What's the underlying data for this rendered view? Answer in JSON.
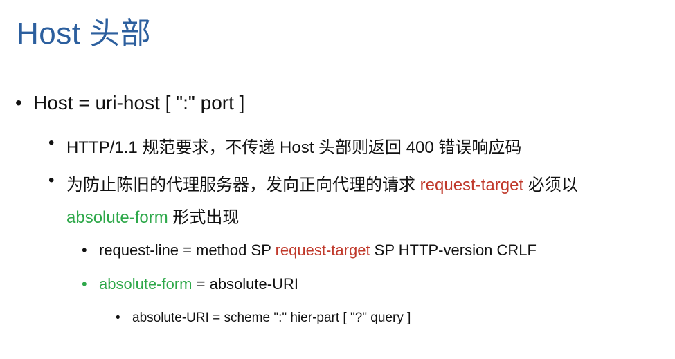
{
  "title": "Host 头部",
  "bullet_char": "•",
  "level1": {
    "text": "Host = uri-host [ \":\" port ]"
  },
  "level2": [
    {
      "text": "HTTP/1.1 规范要求，不传递 Host 头部则返回 400 错误响应码"
    },
    {
      "part1": "为防止陈旧的代理服务器，发向正向代理的请求 ",
      "red": "request-target",
      "part2": " 必须以",
      "line2_green": "absolute-form",
      "line2_rest": " 形式出现"
    }
  ],
  "level3": [
    {
      "part1": "request-line = method SP ",
      "red": "request-target",
      "part2": " SP HTTP-version CRLF"
    },
    {
      "green": "absolute-form",
      "rest": " = absolute-URI"
    }
  ],
  "level4": {
    "text": "absolute-URI = scheme \":\" hier-part [ \"?\" query ]"
  },
  "colors": {
    "title": "#2c5f9e",
    "red": "#c0392b",
    "green": "#2ea84a",
    "text": "#111111"
  }
}
